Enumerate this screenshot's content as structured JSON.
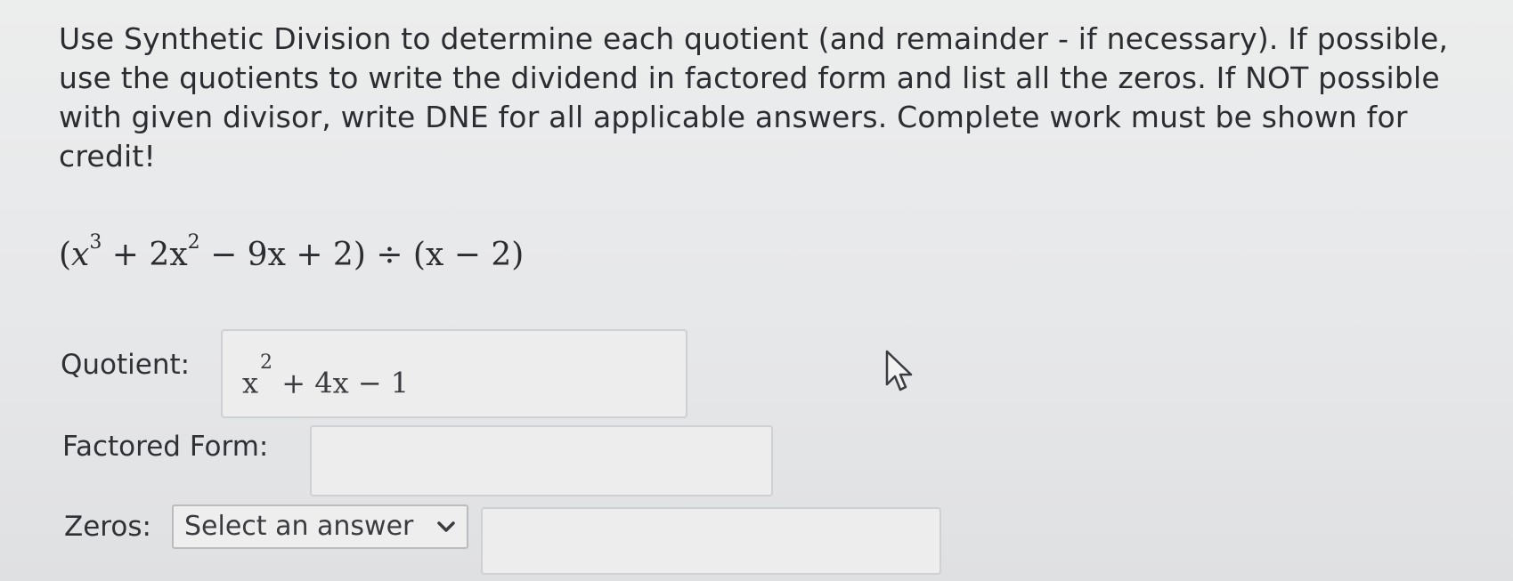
{
  "instructions": "Use Synthetic Division to determine each quotient (and remainder - if necessary). If possible, use the quotients to write the dividend in factored form and list all the zeros. If NOT possible with given divisor, write DNE for all applicable answers. Complete work must be shown for credit!",
  "problem": {
    "open": "(",
    "x1": "x",
    "exp3": "3",
    "t2": " + 2x",
    "exp2": "2",
    "t3": " − 9x + 2) ÷ (x − 2)"
  },
  "quotient": {
    "label": "Quotient:",
    "value_x": "x",
    "value_exp": "2",
    "value_rest": " + 4x − 1"
  },
  "factored": {
    "label": "Factored Form:",
    "value": ""
  },
  "zeros": {
    "label": "Zeros:",
    "select_value": "Select an answer",
    "value": ""
  },
  "icons": {
    "cursor": "mouse-pointer-icon",
    "chevron": "chevron-down-icon"
  }
}
